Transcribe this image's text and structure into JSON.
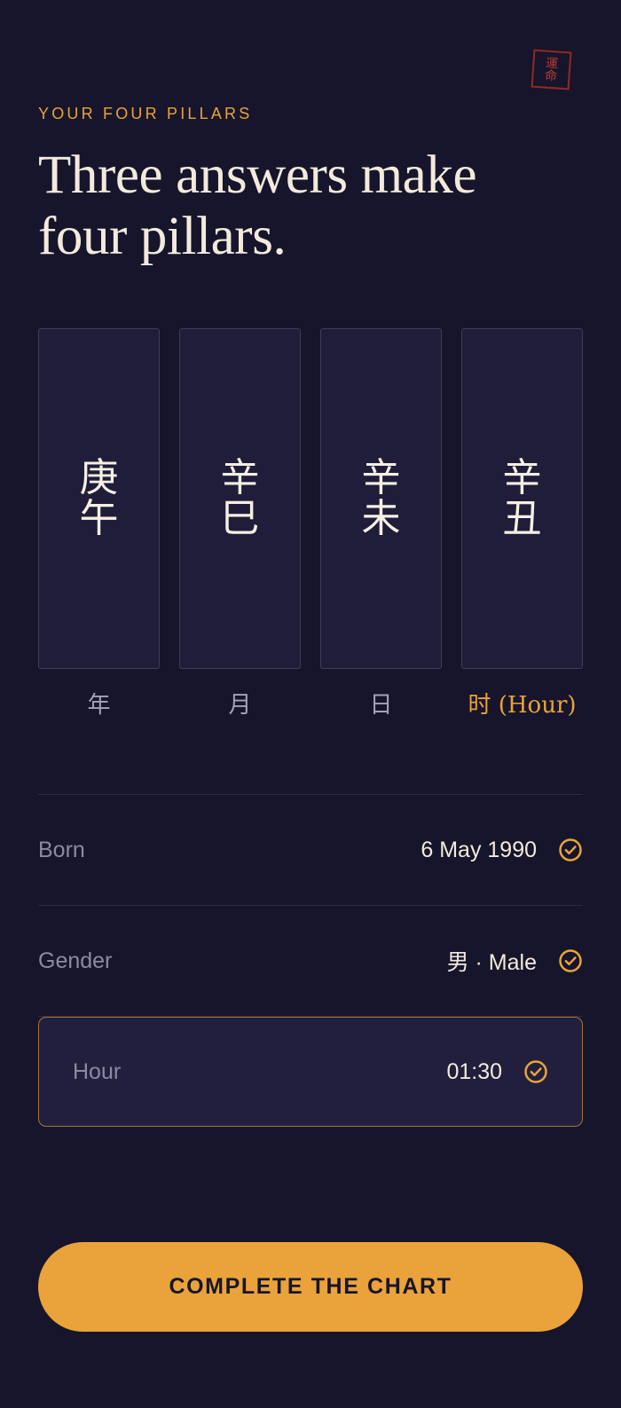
{
  "seal": {
    "text": "運\n命"
  },
  "header": {
    "eyebrow": "YOUR FOUR PILLARS",
    "title": "Three answers make four pillars."
  },
  "pillars": [
    {
      "top": "庚",
      "bottom": "午",
      "label": "年"
    },
    {
      "top": "辛",
      "bottom": "巳",
      "label": "月"
    },
    {
      "top": "辛",
      "bottom": "未",
      "label": "日"
    },
    {
      "top": "辛",
      "bottom": "丑",
      "label": "时 (Hour)",
      "active": true
    }
  ],
  "details": {
    "born": {
      "label": "Born",
      "value": "6 May 1990"
    },
    "gender": {
      "label": "Gender",
      "value": "男 · Male"
    },
    "hour": {
      "label": "Hour",
      "value": "01:30"
    }
  },
  "cta": {
    "label": "COMPLETE THE CHART"
  },
  "colors": {
    "background": "#17152b",
    "accent": "#e9a33a",
    "seal": "#8f2b25",
    "text": "#f3eadc",
    "muted": "#8e899f"
  },
  "icons": {
    "confirmed": "check-circle-icon",
    "seal": "seal-icon"
  }
}
